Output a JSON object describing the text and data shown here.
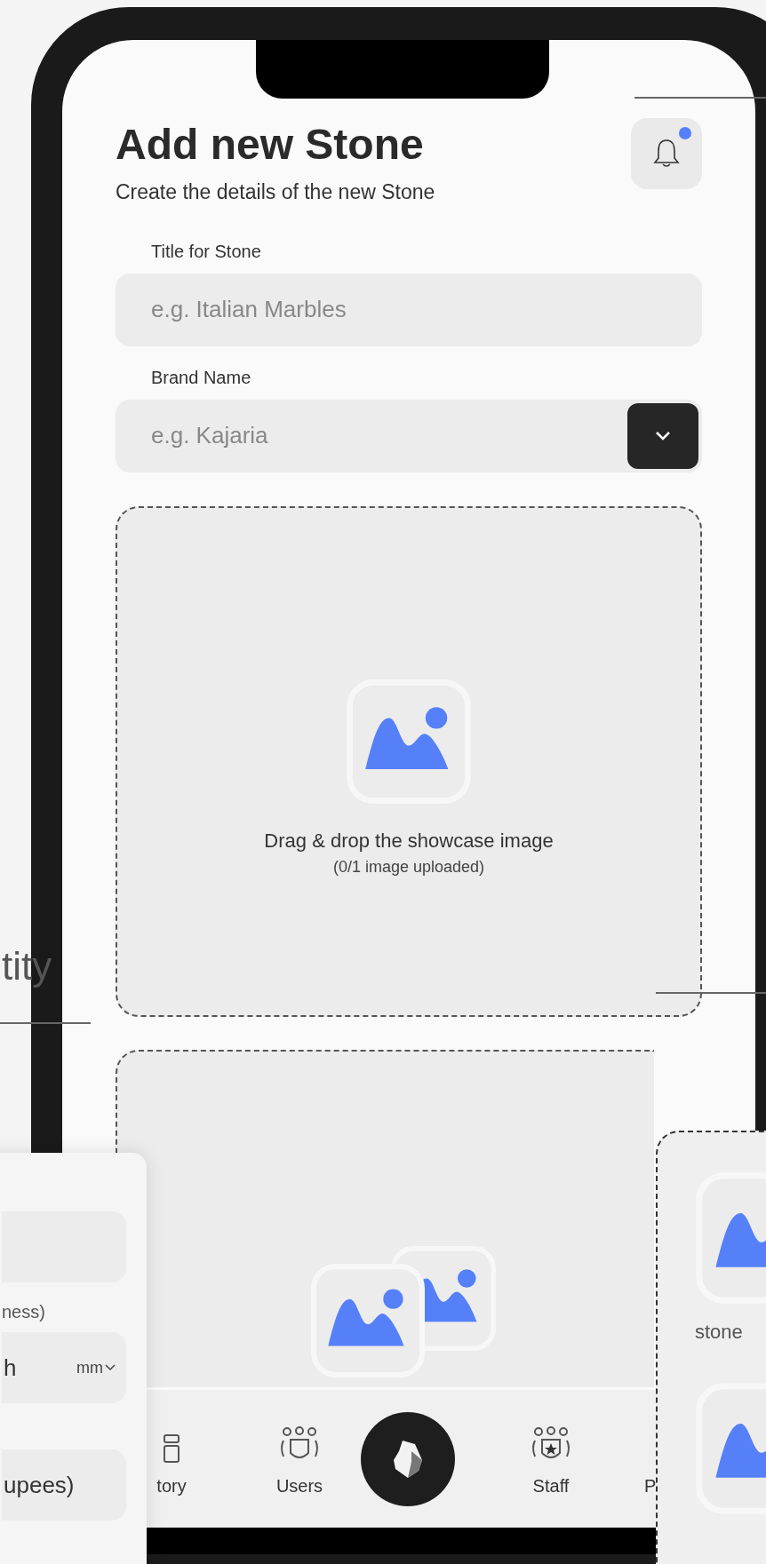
{
  "screen": {
    "title": "Add new Stone",
    "subtitle": "Create the details of the new Stone",
    "notification": {
      "unread": true
    }
  },
  "fields": [
    {
      "label": "Title for Stone",
      "placeholder": "e.g. Italian Marbles",
      "dropdown": false
    },
    {
      "label": "Brand Name",
      "placeholder": "e.g. Kajaria",
      "dropdown": true
    }
  ],
  "upload": {
    "title": "Drag & drop the showcase image",
    "subtitle": "(0/1 image uploaded)"
  },
  "bottom_nav": [
    {
      "label": "tory",
      "kind": "stack"
    },
    {
      "label": "Users",
      "kind": "users"
    },
    {
      "kind": "center"
    },
    {
      "label": "Staff",
      "kind": "staff"
    },
    {
      "label": "P",
      "kind": "blank"
    }
  ],
  "side_caption": "tity",
  "left_card": {
    "fields": [
      {
        "kind": "input"
      },
      {
        "kind": "input",
        "label": "ness)",
        "value": "h",
        "unit": "mm"
      },
      {
        "kind": "input",
        "value": "upees)"
      }
    ]
  },
  "right_card": {
    "items": [
      {
        "kind": "image",
        "label": "stone"
      },
      {
        "kind": "image"
      }
    ]
  }
}
